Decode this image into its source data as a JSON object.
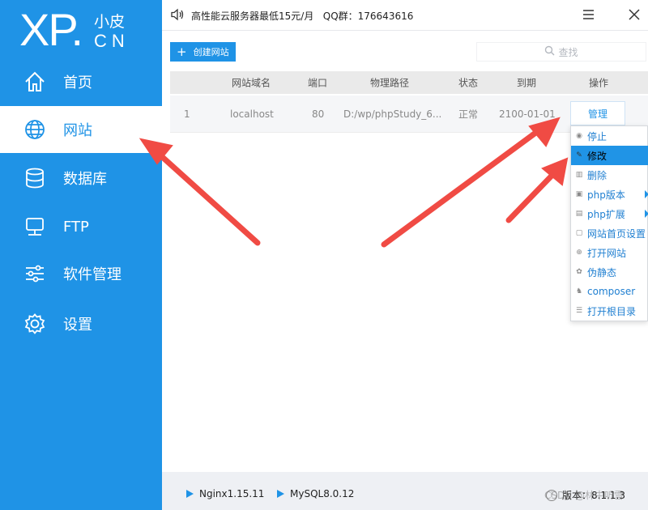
{
  "logo": {
    "main": "XP.",
    "small": "小皮",
    "domain": "CN"
  },
  "sidebar": {
    "items": [
      {
        "label": "首页",
        "icon": "home-icon",
        "active": false
      },
      {
        "label": "网站",
        "icon": "globe-icon",
        "active": true
      },
      {
        "label": "数据库",
        "icon": "database-icon",
        "active": false
      },
      {
        "label": "FTP",
        "icon": "monitor-icon",
        "active": false
      },
      {
        "label": "软件管理",
        "icon": "sliders-icon",
        "active": false
      },
      {
        "label": "设置",
        "icon": "gear-icon",
        "active": false
      }
    ]
  },
  "topbar": {
    "notice": "高性能云服务器最低15元/月   QQ群：176643616"
  },
  "toolbar": {
    "create_label": "创建网站",
    "search_placeholder": "查找"
  },
  "table": {
    "headers": [
      "网站域名",
      "端口",
      "物理路径",
      "状态",
      "到期",
      "操作"
    ],
    "rows": [
      {
        "index": "1",
        "domain": "localhost",
        "port": "80",
        "path": "D:/wp/phpStudy_6...",
        "status": "正常",
        "expires": "2100-01-01",
        "action": "管理"
      }
    ]
  },
  "dropdown": {
    "items": [
      {
        "label": "停止",
        "icon": "stop-icon"
      },
      {
        "label": "修改",
        "icon": "edit-icon",
        "highlighted": true
      },
      {
        "label": "删除",
        "icon": "trash-icon"
      },
      {
        "label": "php版本",
        "icon": "php-version-icon",
        "submenu": true
      },
      {
        "label": "php扩展",
        "icon": "php-extension-icon",
        "submenu": true
      },
      {
        "label": "网站首页设置",
        "icon": "homepage-settings-icon"
      },
      {
        "label": "打开网站",
        "icon": "open-site-icon"
      },
      {
        "label": "伪静态",
        "icon": "rewrite-icon"
      },
      {
        "label": "composer",
        "icon": "composer-icon"
      },
      {
        "label": "打开根目录",
        "icon": "folder-list-icon"
      }
    ]
  },
  "bottombar": {
    "services": [
      "Nginx1.15.11",
      "MySQL8.0.12"
    ],
    "version": "版本：8.1.1.3"
  },
  "watermark": "CSDN @林中听雪",
  "colors": {
    "accent": "#1f93e6",
    "annotation_arrow": "#f04b44"
  }
}
